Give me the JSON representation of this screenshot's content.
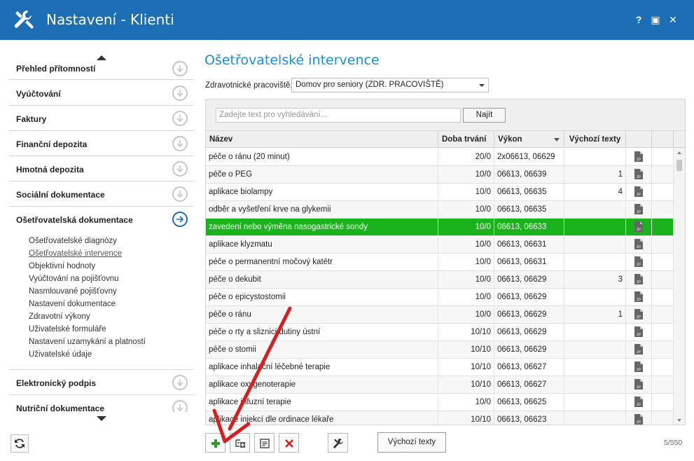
{
  "window": {
    "title": "Nastavení - Klienti",
    "help_label": "?",
    "maximize_label": "▣",
    "close_label": "✕"
  },
  "sidebar": {
    "sections_top": [
      {
        "label": "Přehled přítomností"
      },
      {
        "label": "Vyúčtování"
      },
      {
        "label": "Faktury"
      },
      {
        "label": "Finanční depozita"
      },
      {
        "label": "Hmotná depozita"
      },
      {
        "label": "Sociální dokumentace"
      },
      {
        "label": "Ošetřovatelská dokumentace"
      }
    ],
    "subitems": [
      {
        "label": "Ošetřovatelské diagnózy"
      },
      {
        "label": "Ošetřovatelské intervence"
      },
      {
        "label": "Objektivní hodnoty"
      },
      {
        "label": "Vyúčtování na pojišťovnu"
      },
      {
        "label": "Nasmlouvané pojišťovny"
      },
      {
        "label": "Nastavení dokumentace"
      },
      {
        "label": "Zdravotní výkony"
      },
      {
        "label": "Uživatelské formuláře"
      },
      {
        "label": "Nastavení uzamykání a platností"
      },
      {
        "label": "Uživatelské údaje"
      }
    ],
    "sections_bottom": [
      {
        "label": "Elektronický podpis"
      },
      {
        "label": "Nutriční dokumentace"
      }
    ]
  },
  "main": {
    "heading": "Ošetřovatelské intervence",
    "workplace_label": "Zdravotnické pracoviště:",
    "workplace_value": "Domov pro seniory (ZDR. PRACOVIŠTĚ)",
    "search_placeholder": "Zadejte text pro vyhledávání...",
    "search_button": "Najít",
    "columns": [
      "Název",
      "Doba trvání",
      "Výkon",
      "Výchozí texty"
    ],
    "rows": [
      {
        "name": "péče o ránu (20 minut)",
        "duration": "20/0",
        "code": "2x06613, 06629",
        "default": ""
      },
      {
        "name": "péče o PEG",
        "duration": "10/0",
        "code": "06613, 06639",
        "default": "1"
      },
      {
        "name": "aplikace biolampy",
        "duration": "10/0",
        "code": "06613, 06635",
        "default": "4"
      },
      {
        "name": "odběr a vyšetření krve na glykemii",
        "duration": "10/0",
        "code": "06613, 06635",
        "default": ""
      },
      {
        "name": "zavedení nebo výměna nasogastrické sondy",
        "duration": "10/0",
        "code": "06613, 06633",
        "default": ""
      },
      {
        "name": "aplikace klyzmatu",
        "duration": "10/0",
        "code": "06613, 06631",
        "default": ""
      },
      {
        "name": "péče o permanentní močový katétr",
        "duration": "10/0",
        "code": "06613, 06631",
        "default": ""
      },
      {
        "name": "péče o dekubit",
        "duration": "10/0",
        "code": "06613, 06629",
        "default": "3"
      },
      {
        "name": "péče o epicystostomii",
        "duration": "10/0",
        "code": "06613, 06629",
        "default": ""
      },
      {
        "name": "péče o ránu",
        "duration": "10/0",
        "code": "06613, 06629",
        "default": "1"
      },
      {
        "name": "péče o rty a sliznici dutiny ústní",
        "duration": "10/10",
        "code": "06613, 06629",
        "default": ""
      },
      {
        "name": "péče o stomii",
        "duration": "10/10",
        "code": "06613, 06629",
        "default": ""
      },
      {
        "name": "aplikace inhalační léčebné terapie",
        "duration": "10/10",
        "code": "06613, 06627",
        "default": ""
      },
      {
        "name": "aplikace oxygenoterapie",
        "duration": "10/10",
        "code": "06613, 06627",
        "default": ""
      },
      {
        "name": "aplikace infuzní terapie",
        "duration": "10/0",
        "code": "06613, 06625",
        "default": ""
      },
      {
        "name": "aplikace injekcí dle ordinace lékaře",
        "duration": "10/10",
        "code": "06613, 06623",
        "default": ""
      }
    ],
    "selected_row": 4,
    "default_texts_button": "Výchozí texty",
    "counter": "5/550"
  },
  "colors": {
    "titlebar": "#1c6fb5",
    "accent": "#1c8fd0",
    "selected_row": "#1bb31b",
    "annotation_arrow": "#d42020",
    "add_icon": "#2d9a2d",
    "delete_icon": "#d22020"
  },
  "icons": [
    "wrench-icon",
    "circle-arrow-down-icon",
    "circle-arrow-right-icon",
    "refresh-icon",
    "zp-document-icon",
    "add-icon",
    "add-child-icon",
    "edit-icon",
    "delete-icon",
    "tools-icon"
  ]
}
